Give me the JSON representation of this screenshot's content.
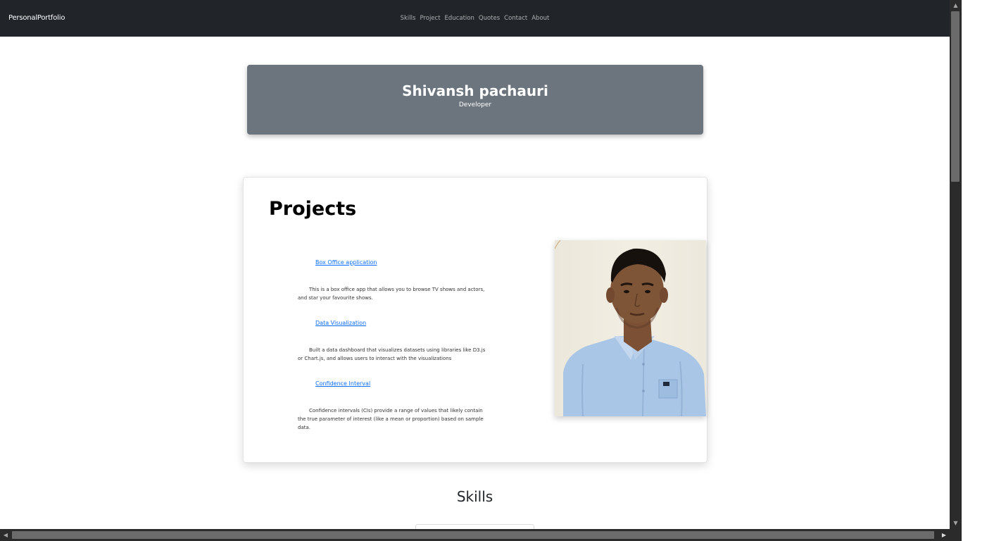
{
  "navbar": {
    "brand": "PersonalPortfolio",
    "links": [
      "Skills",
      "Project",
      "Education",
      "Quotes",
      "Contact",
      "About"
    ]
  },
  "hero": {
    "name": "Shivansh pachauri",
    "role": "Developer"
  },
  "projects": {
    "heading": "Projects",
    "items": [
      {
        "title": "Box Office application",
        "description": "This is a box office app that allows you to browse TV shows and actors, and star your favourite shows."
      },
      {
        "title": "Data Visualization",
        "description": "Built a data dashboard that visualizes datasets using libraries like D3.js or Chart.js, and allows users to interact with the visualizations"
      },
      {
        "title": "Confidence Interval",
        "description": "Confidence intervals (CIs) provide a range of values that likely contain the true parameter of interest (like a mean or proportion) based on sample data."
      }
    ],
    "photo_icon": "profile-photo"
  },
  "skills": {
    "heading": "Skills"
  },
  "scrollbars": {
    "vertical_position": 0.0,
    "horizontal_position": 0.0
  }
}
